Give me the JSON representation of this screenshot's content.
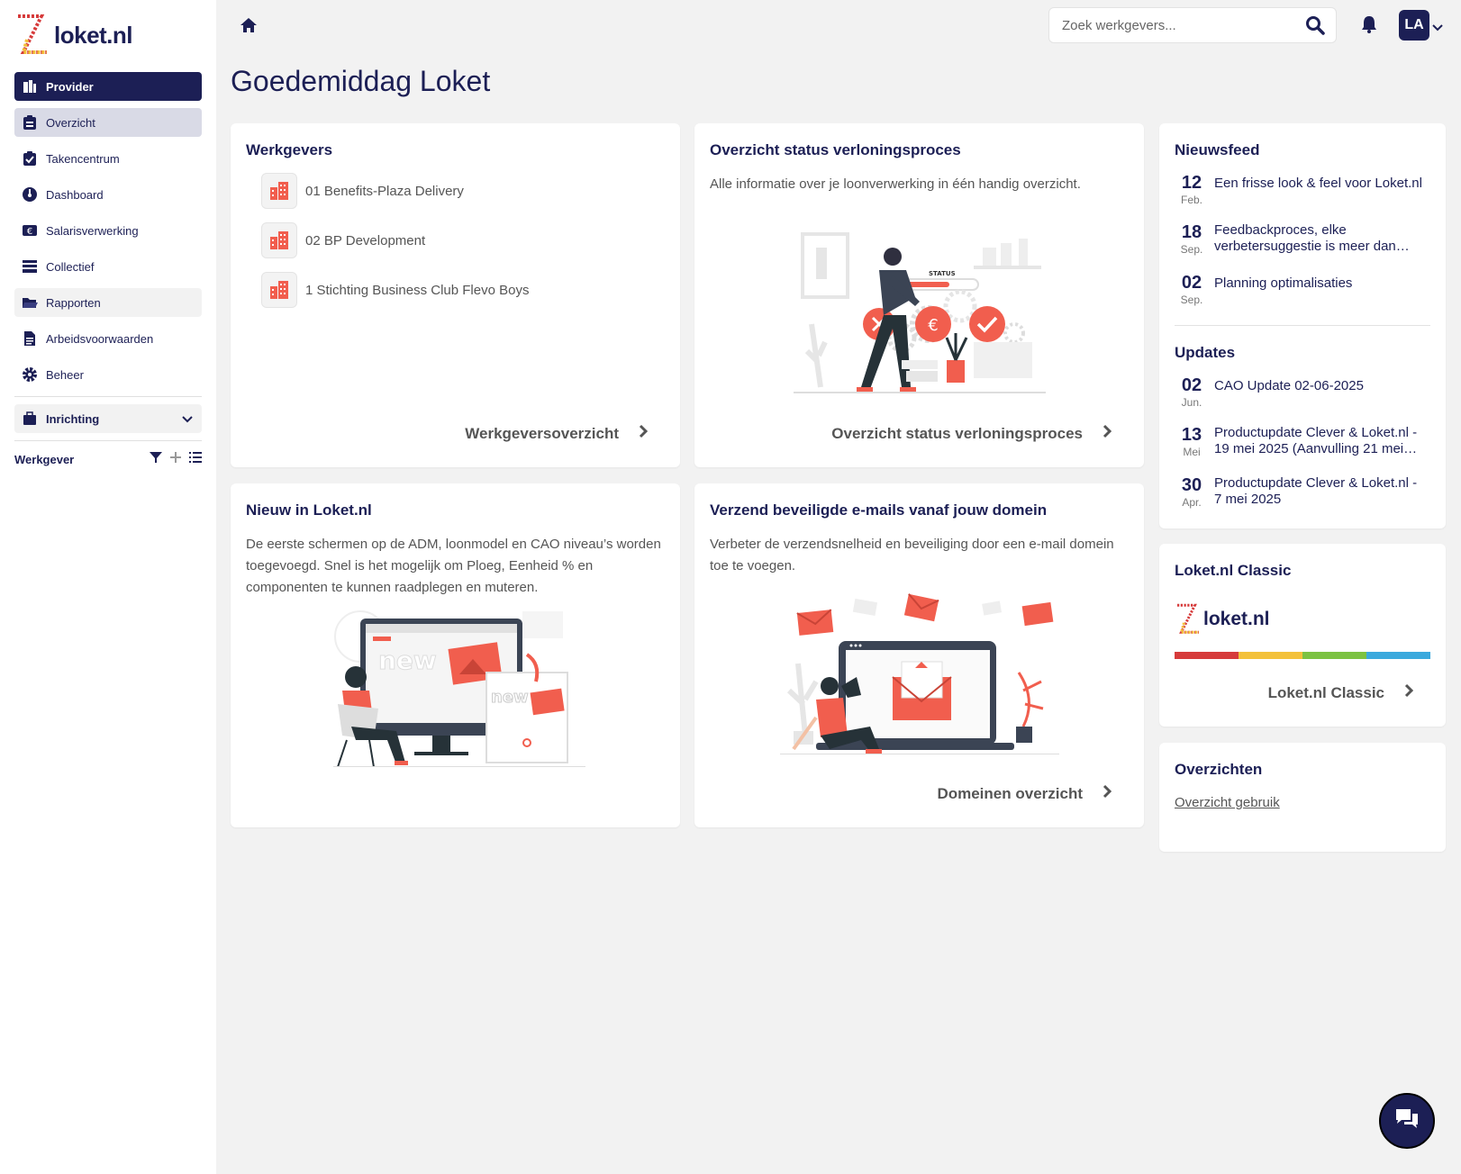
{
  "app": {
    "brand": "loket.nl"
  },
  "sidebar": {
    "provider_label": "Provider",
    "items": [
      {
        "label": "Overzicht",
        "icon": "clipboard-icon"
      },
      {
        "label": "Takencentrum",
        "icon": "clipboard-check-icon"
      },
      {
        "label": "Dashboard",
        "icon": "gauge-icon"
      },
      {
        "label": "Salarisverwerking",
        "icon": "euro-note-icon"
      },
      {
        "label": "Collectief",
        "icon": "inbox-tray-icon"
      },
      {
        "label": "Rapporten",
        "icon": "folder-open-icon"
      },
      {
        "label": "Arbeidsvoorwaarden",
        "icon": "document-icon"
      },
      {
        "label": "Beheer",
        "icon": "gear-icon"
      }
    ],
    "inrichting_label": "Inrichting",
    "werkgever_label": "Werkgever"
  },
  "topbar": {
    "search_placeholder": "Zoek werkgevers...",
    "avatar_initials": "LA"
  },
  "greeting": "Goedemiddag Loket",
  "werkgevers_card": {
    "title": "Werkgevers",
    "employers": [
      "01 Benefits-Plaza Delivery",
      "02 BP Development",
      "1 Stichting Business Club Flevo Boys"
    ],
    "link": "Werkgeversoverzicht"
  },
  "status_card": {
    "title": "Overzicht status verloningsproces",
    "text": "Alle informatie over je loonverwerking in één handig overzicht.",
    "illustration_label": "STATUS",
    "link": "Overzicht status verloningsproces"
  },
  "nieuw_card": {
    "title": "Nieuw in Loket.nl",
    "text_lines": [
      "De eerste schermen op de ADM, loonmodel en CAO niveau’s worden",
      "toegevoegd. Snel is het mogelijk om Ploeg, Eenheid % en",
      "componenten te kunnen raadplegen en muteren."
    ],
    "illustration_words": [
      "new",
      "new"
    ]
  },
  "email_card": {
    "title": "Verzend beveiligde e-mails vanaf jouw domein",
    "text_lines": [
      "Verbeter de verzendsnelheid en beveiliging door een e-mail domein",
      "toe te voegen."
    ],
    "link": "Domeinen overzicht"
  },
  "nieuwsfeed": {
    "title": "Nieuwsfeed",
    "items": [
      {
        "day": "12",
        "month": "Feb.",
        "text": "Een frisse look & feel voor Loket.nl"
      },
      {
        "day": "18",
        "month": "Sep.",
        "text": "Feedbackproces, elke verbetersuggestie is meer dan…"
      },
      {
        "day": "02",
        "month": "Sep.",
        "text": "Planning optimalisaties"
      }
    ],
    "updates_title": "Updates",
    "updates": [
      {
        "day": "02",
        "month": "Jun.",
        "text": "CAO Update 02-06-2025"
      },
      {
        "day": "13",
        "month": "Mei",
        "text": "Productupdate Clever & Loket.nl - 19 mei 2025 (Aanvulling 21 mei…"
      },
      {
        "day": "30",
        "month": "Apr.",
        "text": "Productupdate Clever & Loket.nl - 7 mei 2025"
      }
    ]
  },
  "classic_card": {
    "title": "Loket.nl Classic",
    "brand": "loket.nl",
    "link": "Loket.nl Classic",
    "stripe_colors": [
      "#d63b3b",
      "#f3c13a",
      "#7cc242",
      "#3aa9dd"
    ]
  },
  "overzichten_card": {
    "title": "Overzichten",
    "link": "Overzicht gebruik"
  },
  "colors": {
    "brand_navy": "#1c1f55",
    "accent_red": "#f15e4e"
  }
}
